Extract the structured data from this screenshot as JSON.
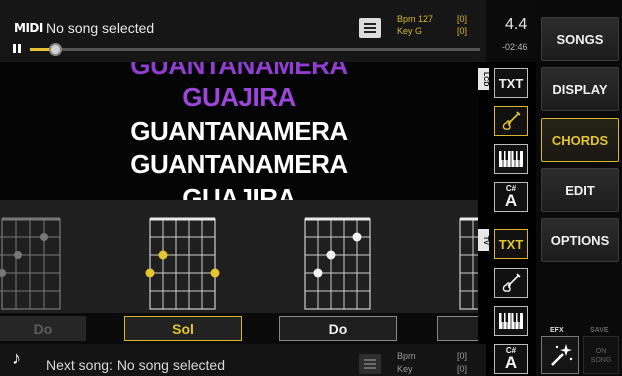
{
  "header": {
    "midi_logo": "MIDI",
    "song_title": "No song selected",
    "bpm_label": "Bpm 127",
    "bpm_value": "[0]",
    "key_label": "Key G",
    "key_value": "[0]",
    "time_signature": "4.4",
    "time_remaining": "-02:46",
    "progress_fraction": 0.055
  },
  "lyrics": [
    "GUANTANAMERA",
    "GUAJIRA",
    "GUANTANAMERA",
    "GUANTANAMERA",
    "GUAJIRA"
  ],
  "nav": {
    "songs": "SONGS",
    "display": "DISPLAY",
    "chords": "CHORDS",
    "edit": "EDIT",
    "options": "OPTIONS",
    "efx": "EFX",
    "save": "SAVE",
    "save_button_line1": "ON",
    "save_button_line2": "SONG"
  },
  "tools": {
    "lcd_tab": "LCD",
    "tv_tab": "TV",
    "txt": "TXT",
    "key_sharp": "C#",
    "key_letter": "A"
  },
  "chords": {
    "markers_left": [
      "○",
      "○"
    ],
    "markers_sol": [
      "○",
      "○",
      "○"
    ],
    "markers_do": [
      "×",
      "○",
      "○"
    ],
    "markers_right": [
      "×",
      ">"
    ],
    "names": {
      "do_left": "Do",
      "sol": "Sol",
      "do_right": "Do"
    }
  },
  "footer": {
    "note_glyph": "♪",
    "next_song": "Next song: No song selected",
    "bpm_label": "Bpm",
    "bpm_value": "[0]",
    "key_label": "Key",
    "key_value": "[0]"
  },
  "colors": {
    "accent": "#e4c431",
    "lyric_highlight": "#9b47dc",
    "background": "#000000"
  }
}
